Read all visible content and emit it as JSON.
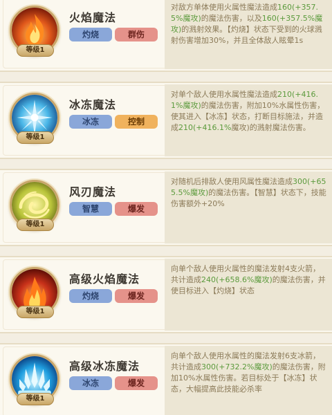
{
  "skills": [
    {
      "name": "火焰魔法",
      "level": "等级1",
      "icon": "fire-icon",
      "tags": [
        {
          "label": "灼烧",
          "color": "blue"
        },
        {
          "label": "群伤",
          "color": "red"
        }
      ],
      "desc": [
        {
          "t": "对敌方单体使用火属性魔法造成"
        },
        {
          "t": "160(+357.5%魔攻)",
          "hl": true
        },
        {
          "t": "的魔法伤害，以及"
        },
        {
          "t": "160(+357.5%魔攻)",
          "hl": true
        },
        {
          "t": "的溅射效果。【灼烧】状态下受到的火球溅射伤害增加30%，并且全体敌人眩晕1s"
        }
      ]
    },
    {
      "name": "冰冻魔法",
      "level": "等级1",
      "icon": "ice-icon",
      "tags": [
        {
          "label": "冰冻",
          "color": "blue"
        },
        {
          "label": "控制",
          "color": "orange"
        }
      ],
      "desc": [
        {
          "t": "对单个敌人使用水属性魔法造成"
        },
        {
          "t": "210(+416.1%魔攻)",
          "hl": true
        },
        {
          "t": "的魔法伤害，附加10%水属性伤害，使其进入【冰冻】状态，打断目标施法，并造成"
        },
        {
          "t": "210(+416.1%",
          "hl": true
        },
        {
          "t": "魔攻)的溅射魔法伤害。"
        }
      ]
    },
    {
      "name": "风刃魔法",
      "level": "等级1",
      "icon": "wind-icon",
      "tags": [
        {
          "label": "智慧",
          "color": "blue"
        },
        {
          "label": "爆发",
          "color": "red"
        }
      ],
      "desc": [
        {
          "t": "对随机后排敌人使用风属性魔法造成"
        },
        {
          "t": "300(+655.5%魔攻)",
          "hl": true
        },
        {
          "t": "的魔法伤害。【智慧】状态下，技能伤害额外+20%"
        }
      ]
    },
    {
      "name": "高级火焰魔法",
      "level": "等级1",
      "icon": "fire-icon",
      "tags": [
        {
          "label": "灼烧",
          "color": "blue"
        },
        {
          "label": "爆发",
          "color": "red"
        }
      ],
      "desc": [
        {
          "t": "向单个敌人使用火属性的魔法发射4支火箭，共计造成"
        },
        {
          "t": "240(+658.6%魔攻)",
          "hl": true
        },
        {
          "t": "的魔法伤害，并使目标进入【灼烧】状态"
        }
      ]
    },
    {
      "name": "高级冰冻魔法",
      "level": "等级1",
      "icon": "ice-icon",
      "tags": [
        {
          "label": "冰冻",
          "color": "blue"
        },
        {
          "label": "爆发",
          "color": "red"
        }
      ],
      "desc": [
        {
          "t": "向单个敌人使用水属性的魔法发射6支冰箭，共计造成"
        },
        {
          "t": "300(+732.2%魔攻)",
          "hl": true
        },
        {
          "t": "的魔法伤害，附加10%水属性伤害。若目标处于【冰冻】状态，大幅提高此技能必杀率"
        }
      ]
    }
  ]
}
